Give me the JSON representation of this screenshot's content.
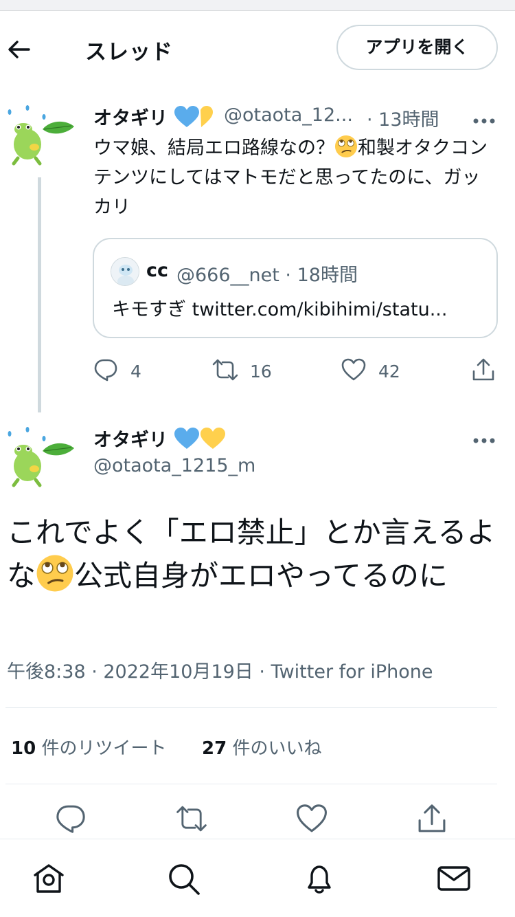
{
  "header": {
    "title": "スレッド",
    "open_app_label": "アプリを開く"
  },
  "tweet1": {
    "name": "オタギリ",
    "handle": "@otaota_12...",
    "time": "· 13時間",
    "text_part1": "ウマ娘、結局エロ路線なの？",
    "text_part2": "和製オタクコンテンツにしてはマトモだと思ってたのに、ガッカリ",
    "quote": {
      "name": "cc",
      "handle_time": "@666__net · 18時間",
      "text": "キモすぎ twitter.com/kibihimi/statu..."
    },
    "replies": "4",
    "retweets": "16",
    "likes": "42"
  },
  "tweet2": {
    "name": "オタギリ",
    "handle": "@otaota_1215_m",
    "text_part1": "これでよく「エロ禁止」とか言えるよな",
    "text_part2": "公式自身がエロやってるのに",
    "meta": "午後8:38 · 2022年10月19日 · Twitter for iPhone",
    "retweet_count": "10",
    "retweet_label": " 件のリツイート",
    "like_count": "27",
    "like_label": " 件のいいね"
  },
  "icons": {
    "back": "arrow-left-icon",
    "more": "more-dots-icon",
    "reply": "reply-icon",
    "retweet": "retweet-icon",
    "like": "heart-icon",
    "share": "share-icon",
    "nav": [
      "home-icon",
      "search-icon",
      "bell-icon",
      "mail-icon"
    ]
  },
  "colors": {
    "accent": "#1d9bf0",
    "muted_text": "#536471",
    "border": "#cfd9de",
    "blue_heart": "#5aacec",
    "yellow_heart": "#ffd04d",
    "frog_green": "#8fd14f",
    "leaf_green": "#4cae3a"
  }
}
